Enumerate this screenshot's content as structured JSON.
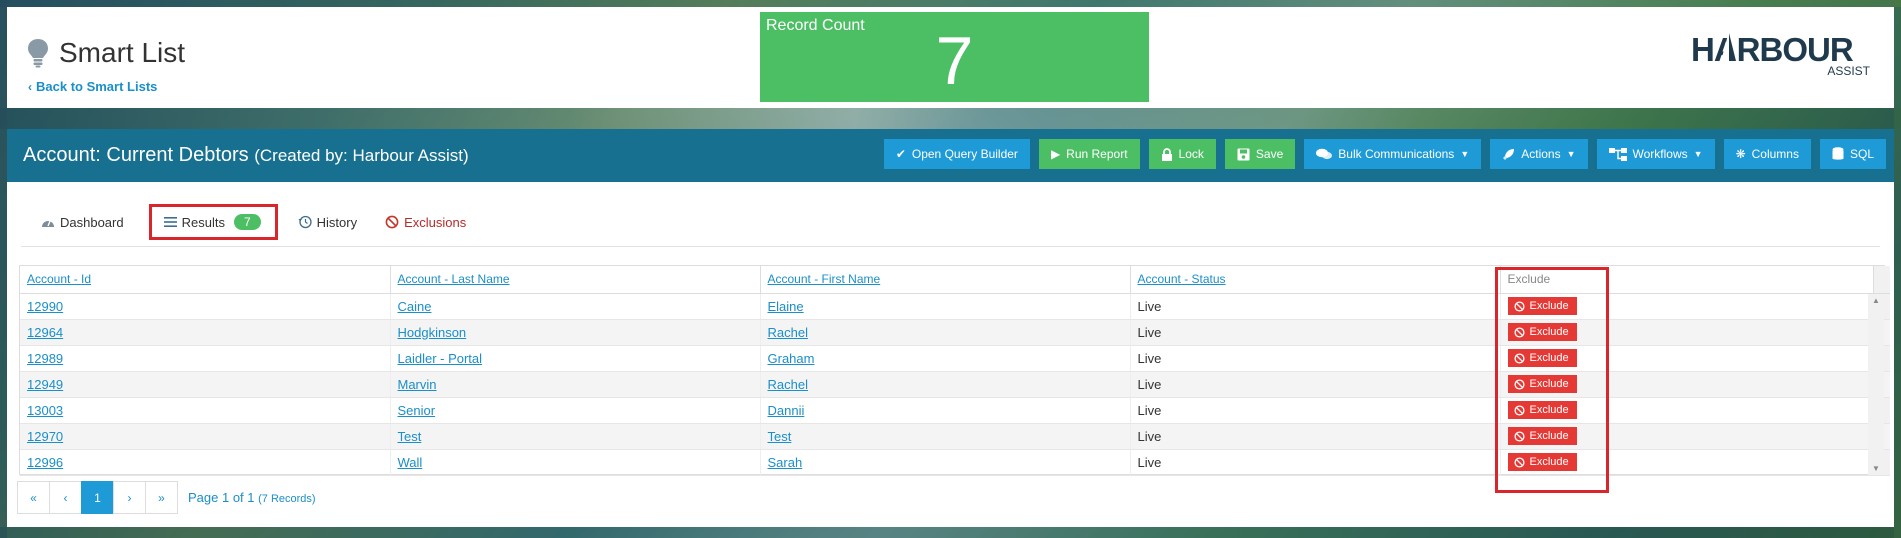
{
  "header": {
    "title": "Smart List",
    "back_link": "Back to Smart Lists",
    "record_count_label": "Record Count",
    "record_count_value": "7",
    "logo_main": "HARBOUR",
    "logo_sub": "ASSIST"
  },
  "list": {
    "title": "Account: Current Debtors",
    "created_by": "(Created by: Harbour Assist)"
  },
  "toolbar": [
    {
      "label": "Open Query Builder",
      "icon": "check-icon",
      "color": "#1e9ad6",
      "dropdown": false
    },
    {
      "label": "Run Report",
      "icon": "play-icon",
      "color": "#4cbf65",
      "dropdown": false
    },
    {
      "label": "Lock",
      "icon": "lock-icon",
      "color": "#4cbf65",
      "dropdown": false
    },
    {
      "label": "Save",
      "icon": "save-icon",
      "color": "#4cbf65",
      "dropdown": false
    },
    {
      "label": "Bulk Communications",
      "icon": "comments-icon",
      "color": "#1e9ad6",
      "dropdown": true
    },
    {
      "label": "Actions",
      "icon": "rocket-icon",
      "color": "#1e9ad6",
      "dropdown": true
    },
    {
      "label": "Workflows",
      "icon": "sitemap-icon",
      "color": "#1e9ad6",
      "dropdown": true
    },
    {
      "label": "Columns",
      "icon": "cog-icon",
      "color": "#1e9ad6",
      "dropdown": false
    },
    {
      "label": "SQL",
      "icon": "database-icon",
      "color": "#1e9ad6",
      "dropdown": false
    }
  ],
  "tabs": {
    "dashboard": "Dashboard",
    "results": "Results",
    "results_count": "7",
    "history": "History",
    "exclusions": "Exclusions"
  },
  "table": {
    "headers": [
      "Account - Id",
      "Account - Last Name",
      "Account - First Name",
      "Account - Status",
      "Exclude"
    ],
    "exclude_button": "Exclude",
    "rows": [
      [
        "12990",
        "Caine",
        "Elaine",
        "Live"
      ],
      [
        "12964",
        "Hodgkinson",
        "Rachel",
        "Live"
      ],
      [
        "12989",
        "Laidler - Portal",
        "Graham",
        "Live"
      ],
      [
        "12949",
        "Marvin",
        "Rachel",
        "Live"
      ],
      [
        "13003",
        "Senior",
        "Dannii",
        "Live"
      ],
      [
        "12970",
        "Test",
        "Test",
        "Live"
      ],
      [
        "12996",
        "Wall",
        "Sarah",
        "Live"
      ]
    ]
  },
  "pagination": {
    "first": "«",
    "prev": "‹",
    "current": "1",
    "next": "›",
    "last": "»",
    "info": "Page 1 of 1",
    "records": "(7 Records)"
  }
}
